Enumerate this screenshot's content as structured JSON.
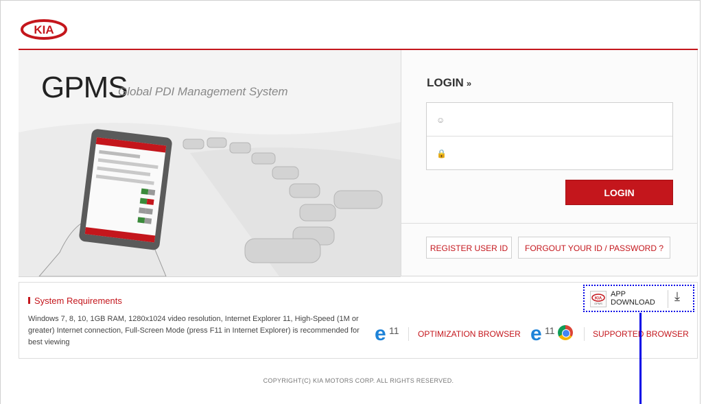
{
  "brand": {
    "logo_text": "KIA",
    "accent_color": "#c4161c",
    "annotation_color": "#0000e6"
  },
  "hero": {
    "title": "GPMS",
    "subtitle": "Global PDI Management System"
  },
  "login": {
    "heading": "LOGIN",
    "heading_suffix": "»",
    "username_value": "",
    "password_value": "",
    "username_icon": "user-icon",
    "password_icon": "lock-icon",
    "button_label": "LOGIN",
    "register_label": "REGISTER USER ID",
    "forgot_label": "FORGOUT YOUR ID / PASSWORD ?"
  },
  "system": {
    "title": "System Requirements",
    "text": "Windows 7, 8, 10, 1GB RAM, 1280x1024 video resolution, Internet Explorer 11, High-Speed (1M or greater) Internet connection, Full-Screen Mode (press F11 in Internet Explorer) is recommended for best viewing",
    "app_download_line1": "APP",
    "app_download_line2": "DOWNLOAD",
    "app_logo_text": "KIA",
    "app_logo_sub": "GPMS",
    "ie_version": "11",
    "optimization_label": "OPTIMIZATION BROWSER",
    "supported_label": "SUPPORTED BROWSER"
  },
  "footer": {
    "copyright": "COPYRIGHT(C) KIA MOTORS CORP. ALL RIGHTS RESERVED."
  }
}
